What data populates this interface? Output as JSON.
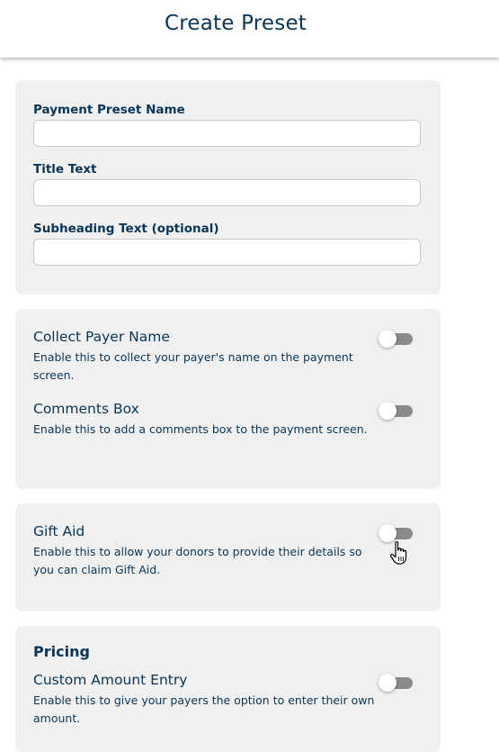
{
  "header": {
    "title": "Create Preset"
  },
  "form": {
    "preset_name": {
      "label": "Payment Preset Name",
      "value": "",
      "placeholder": ""
    },
    "title_text": {
      "label": "Title Text",
      "value": "",
      "placeholder": ""
    },
    "subheading_text": {
      "label": "Subheading Text (optional)",
      "value": "",
      "placeholder": ""
    }
  },
  "options": {
    "collect_payer_name": {
      "title": "Collect Payer Name",
      "description": "Enable this to collect your payer's name on the payment screen.",
      "enabled": false
    },
    "comments_box": {
      "title": "Comments Box",
      "description": "Enable this to add a comments box to the payment screen.",
      "enabled": false
    },
    "gift_aid": {
      "title": "Gift Aid",
      "description": "Enable this to allow your donors to provide their details so you can claim Gift Aid.",
      "enabled": false
    }
  },
  "pricing": {
    "heading": "Pricing",
    "custom_amount_entry": {
      "title": "Custom Amount Entry",
      "description": "Enable this to give your payers the option to enter their own amount.",
      "enabled": false
    }
  },
  "cursor": {
    "icon": "hand-pointer-icon"
  },
  "colors": {
    "text": "#0b3556",
    "card_background": "#f0f0f0",
    "toggle_off_track": "#8a8a8a"
  }
}
